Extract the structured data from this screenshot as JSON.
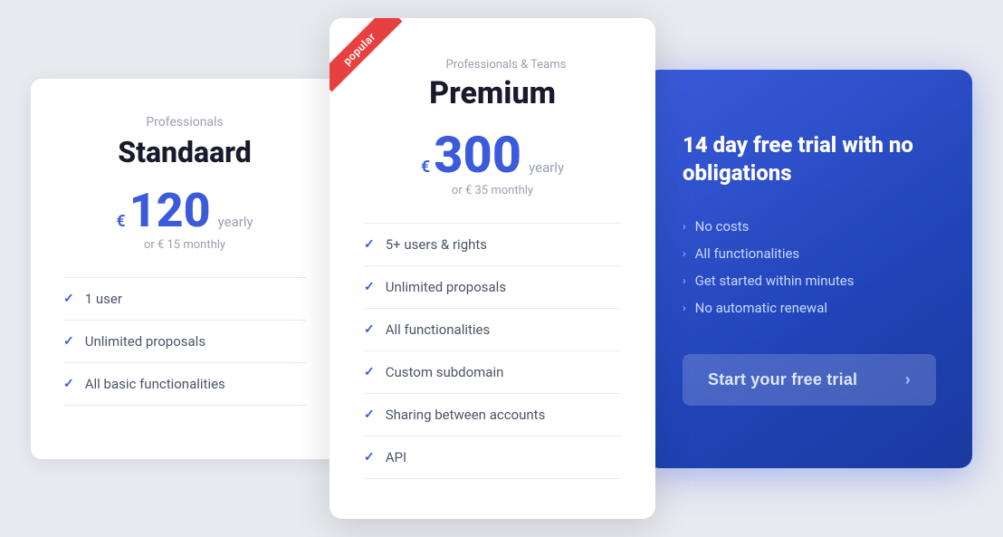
{
  "standard": {
    "plan_type": "Professionals",
    "plan_name": "Standaard",
    "currency": "€",
    "price": "120",
    "period": "yearly",
    "alt_price": "or &euro; 15 monthly",
    "features": [
      "1 user",
      "Unlimited proposals",
      "All basic functionalities"
    ]
  },
  "premium": {
    "plan_type": "Professionals & Teams",
    "plan_name": "Premium",
    "currency": "€",
    "price": "300",
    "period": "yearly",
    "alt_price": "or &euro; 35 monthly",
    "badge": "popular",
    "features": [
      "5+ users & rights",
      "Unlimited proposals",
      "All functionalities",
      "Custom subdomain",
      "Sharing between accounts",
      "API"
    ]
  },
  "trial": {
    "title": "14 day free trial with no obligations",
    "features": [
      "No costs",
      "All functionalities",
      "Get started within minutes",
      "No automatic renewal"
    ],
    "button_label": "Start your free trial"
  }
}
